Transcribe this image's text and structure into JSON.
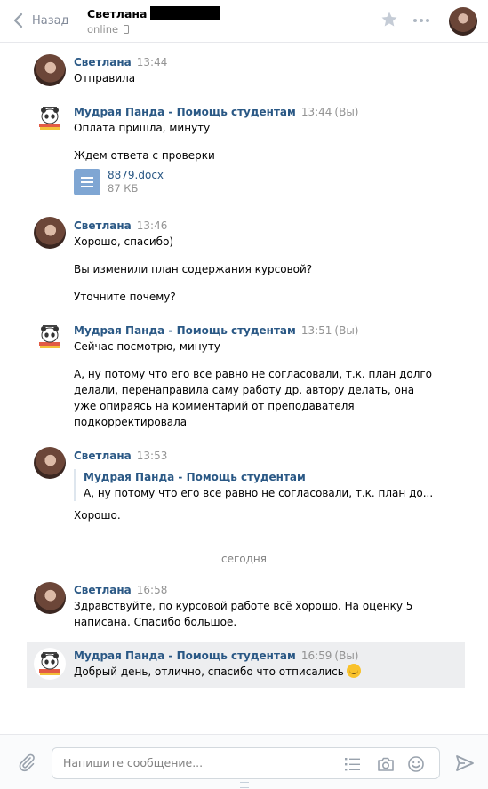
{
  "header": {
    "back_label": "Назад",
    "peer_name": "Светлана",
    "peer_status": "online"
  },
  "messages": [
    {
      "author": "Светлана",
      "time": "13:44",
      "text": "Отправила"
    },
    {
      "author": "Мудрая Панда - Помощь студентам",
      "time": "13:44",
      "you": "(Вы)",
      "lines": [
        "Оплата пришла, минуту",
        "Ждем ответа с проверки"
      ],
      "doc": {
        "name": "8879.docx",
        "size": "87 КБ"
      }
    },
    {
      "author": "Светлана",
      "time": "13:46",
      "lines": [
        "Хорошо, спасибо)",
        "Вы изменили план содержания курсовой?",
        "Уточните почему?"
      ]
    },
    {
      "author": "Мудрая Панда - Помощь студентам",
      "time": "13:51",
      "you": "(Вы)",
      "lines": [
        "Сейчас посмотрю, минуту",
        "А, ну потому что его все равно не согласовали, т.к. план долго",
        "делали, перенаправила саму работу др. автору делать, она",
        "уже опираясь на комментарий от преподавателя",
        "подкорректировала"
      ]
    },
    {
      "author": "Светлана",
      "time": "13:53",
      "quote": {
        "author": "Мудрая Панда - Помощь студентам",
        "text": "А, ну потому что его все равно не согласовали, т.к. план до..."
      },
      "text": "Хорошо."
    },
    {
      "author": "Светлана",
      "time": "16:58",
      "lines": [
        "Здравствуйте, по курсовой работе всё хорошо. На оценку 5",
        "написана. Спасибо большое."
      ]
    },
    {
      "author": "Мудрая Панда - Помощь студентам",
      "time": "16:59",
      "you": "(Вы)",
      "text": "Добрый день, отлично, спасибо что отписались"
    }
  ],
  "date_separator": "сегодня",
  "composer": {
    "placeholder": "Напишите сообщение..."
  },
  "icons": [
    "chevron-left-icon",
    "phone-icon",
    "star-icon",
    "more-icon",
    "document-icon",
    "smile-emoji-icon",
    "paperclip-icon",
    "list-icon",
    "camera-icon",
    "smile-icon",
    "send-icon"
  ],
  "colors": {
    "link": "#2a5885",
    "muted": "#939393",
    "highlight": "#edeef0",
    "doc": "#7fa6d3"
  }
}
